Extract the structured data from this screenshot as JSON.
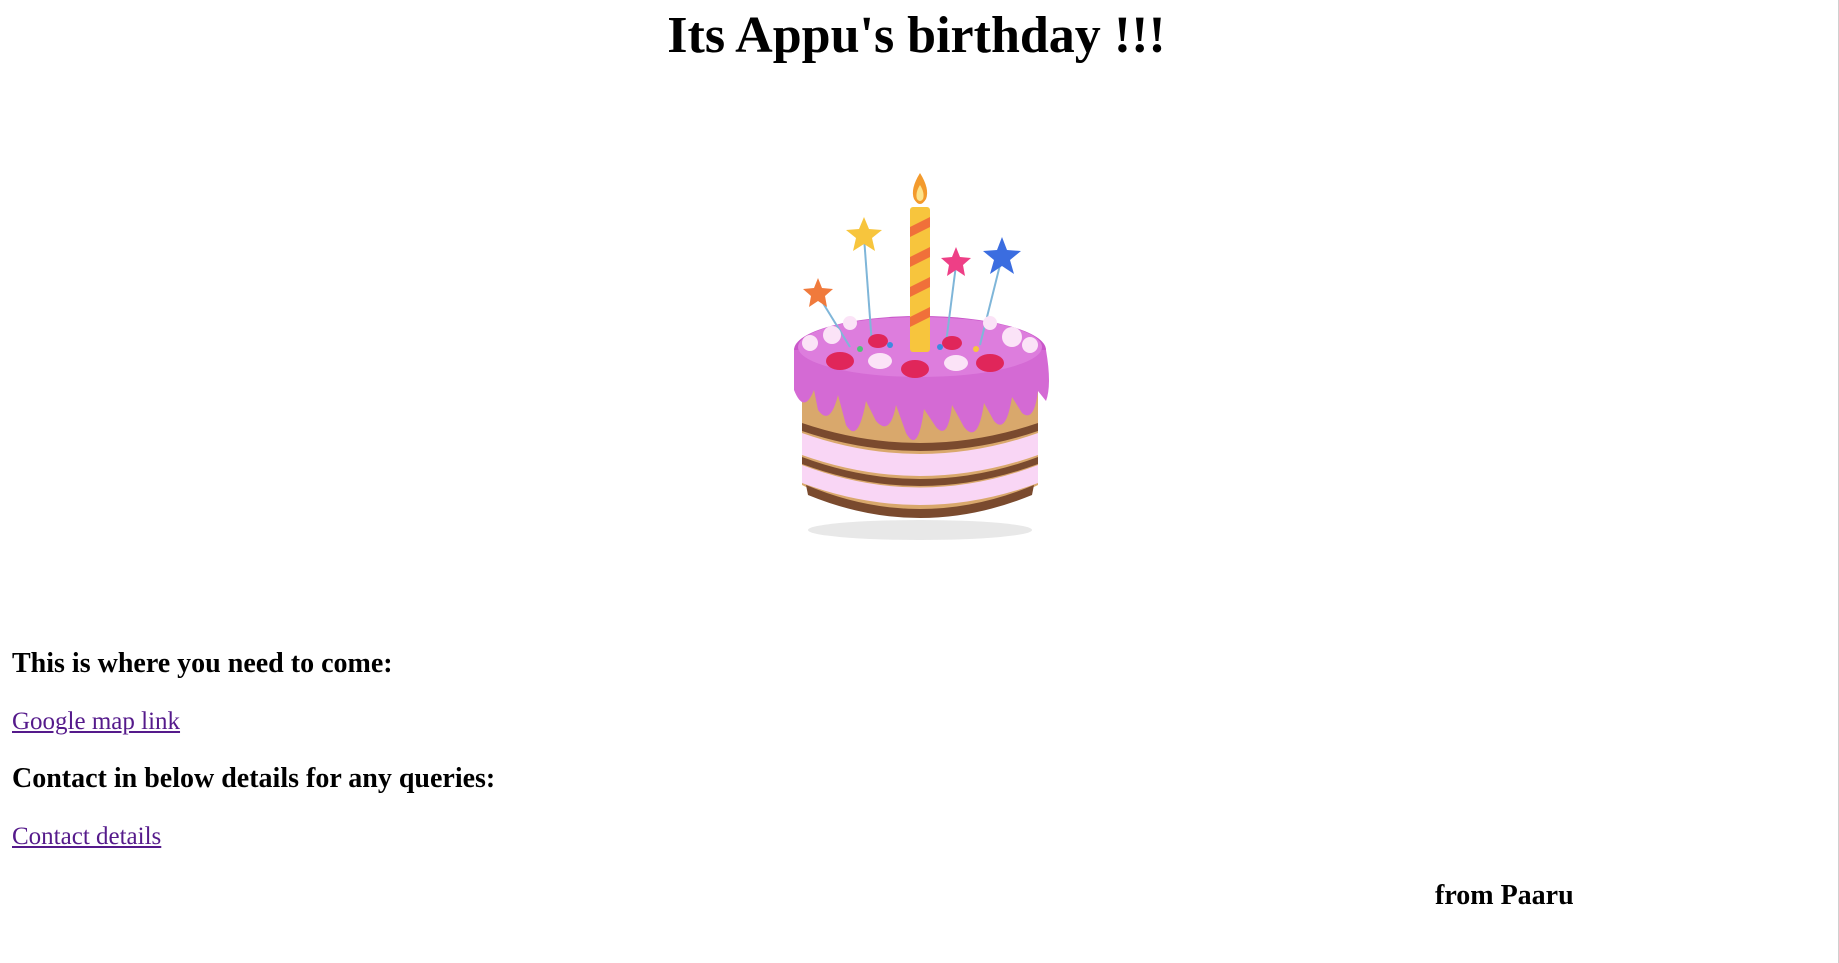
{
  "page": {
    "title": "Its Appu's birthday !!!"
  },
  "image": {
    "alt": "birthday-cake",
    "icon": "birthday-cake-icon"
  },
  "sections": {
    "where_heading": "This is where you need to come:",
    "map_link": "Google map link",
    "contact_heading": "Contact in below details for any queries:",
    "contact_link": "Contact details"
  },
  "footer": {
    "signoff": "from Paaru"
  },
  "colors": {
    "background": "#ffffff",
    "text": "#000000",
    "visited_link": "#551a8b",
    "frosting": "#d46ad4",
    "sponge": "#d9a86c",
    "cream": "#f9d6f5"
  }
}
